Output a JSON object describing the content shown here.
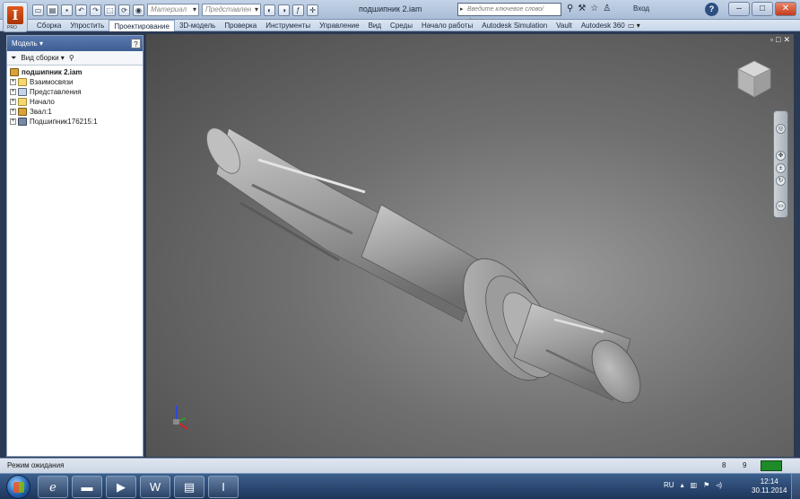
{
  "app": {
    "logo_letter": "I",
    "logo_sub": "PRO"
  },
  "quick_access": {
    "material_placeholder": "Материал",
    "appearance_placeholder": "Представлен"
  },
  "title": "подшипник 2.iam",
  "search": {
    "placeholder": "Введите ключевое слово/фразу"
  },
  "sign_in": "Вход",
  "help_label": "?",
  "ribbon": {
    "tabs": [
      "Сборка",
      "Упростить",
      "Проектирование",
      "3D-модель",
      "Проверка",
      "Инструменты",
      "Управление",
      "Вид",
      "Среды",
      "Начало работы",
      "Autodesk Simulation",
      "Vault",
      "Autodesk 360"
    ],
    "active_tab": "Проектирование"
  },
  "browser": {
    "title": "Модель",
    "view_label": "Вид сборки",
    "help": "?",
    "items": [
      {
        "label": "подшипник 2.iam",
        "icon": "assembly-icon",
        "expander": ""
      },
      {
        "label": "Взаимосвязи",
        "icon": "folder-icon",
        "expander": "+"
      },
      {
        "label": "Представления",
        "icon": "representations-icon",
        "expander": "+"
      },
      {
        "label": "Начало",
        "icon": "folder-icon",
        "expander": "+"
      },
      {
        "label": "Звал:1",
        "icon": "part-icon",
        "expander": "+"
      },
      {
        "label": "Подшипник176215:1",
        "icon": "part-icon",
        "expander": "+"
      }
    ]
  },
  "status": {
    "text": "Режим ожидания",
    "count_a": "8",
    "count_b": "9"
  },
  "taskbar": {
    "language": "RU",
    "time": "12:14",
    "date": "30.11.2014",
    "apps": [
      "internet-explorer-icon",
      "explorer-folder-icon",
      "media-player-icon",
      "word-icon",
      "notepad-icon",
      "inventor-icon"
    ]
  },
  "colors": {
    "ribbon_active_tab": "#ffffff",
    "browser_header": "#4a6aa0",
    "status_indicator": "#1f8a2a",
    "model_grey": "#9c9c9c"
  }
}
